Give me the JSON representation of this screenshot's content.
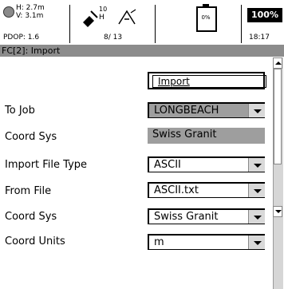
{
  "status": {
    "h_precision": "H: 2.7m",
    "v_precision": "V: 3.1m",
    "pdop": "PDOP: 1.6",
    "sats_top": "10",
    "sats_h": "H",
    "sats_count": "8/ 13",
    "battery_pct_small": "0%",
    "battery_level": 0.0,
    "big_pct": "100%",
    "time": "18:17"
  },
  "title": "FC[2]: Import",
  "import_button_label": "Import",
  "fields": [
    {
      "label": "To Job",
      "value": "LONGBEACH"
    },
    {
      "label": "Coord Sys",
      "value": "Swiss Granit"
    },
    {
      "label": "Import File Type",
      "value": "ASCII"
    },
    {
      "label": "From File",
      "value": "ASCII.txt"
    },
    {
      "label": "Coord Sys",
      "value": "Swiss Granit"
    },
    {
      "label": "Coord Units",
      "value": "m"
    }
  ]
}
